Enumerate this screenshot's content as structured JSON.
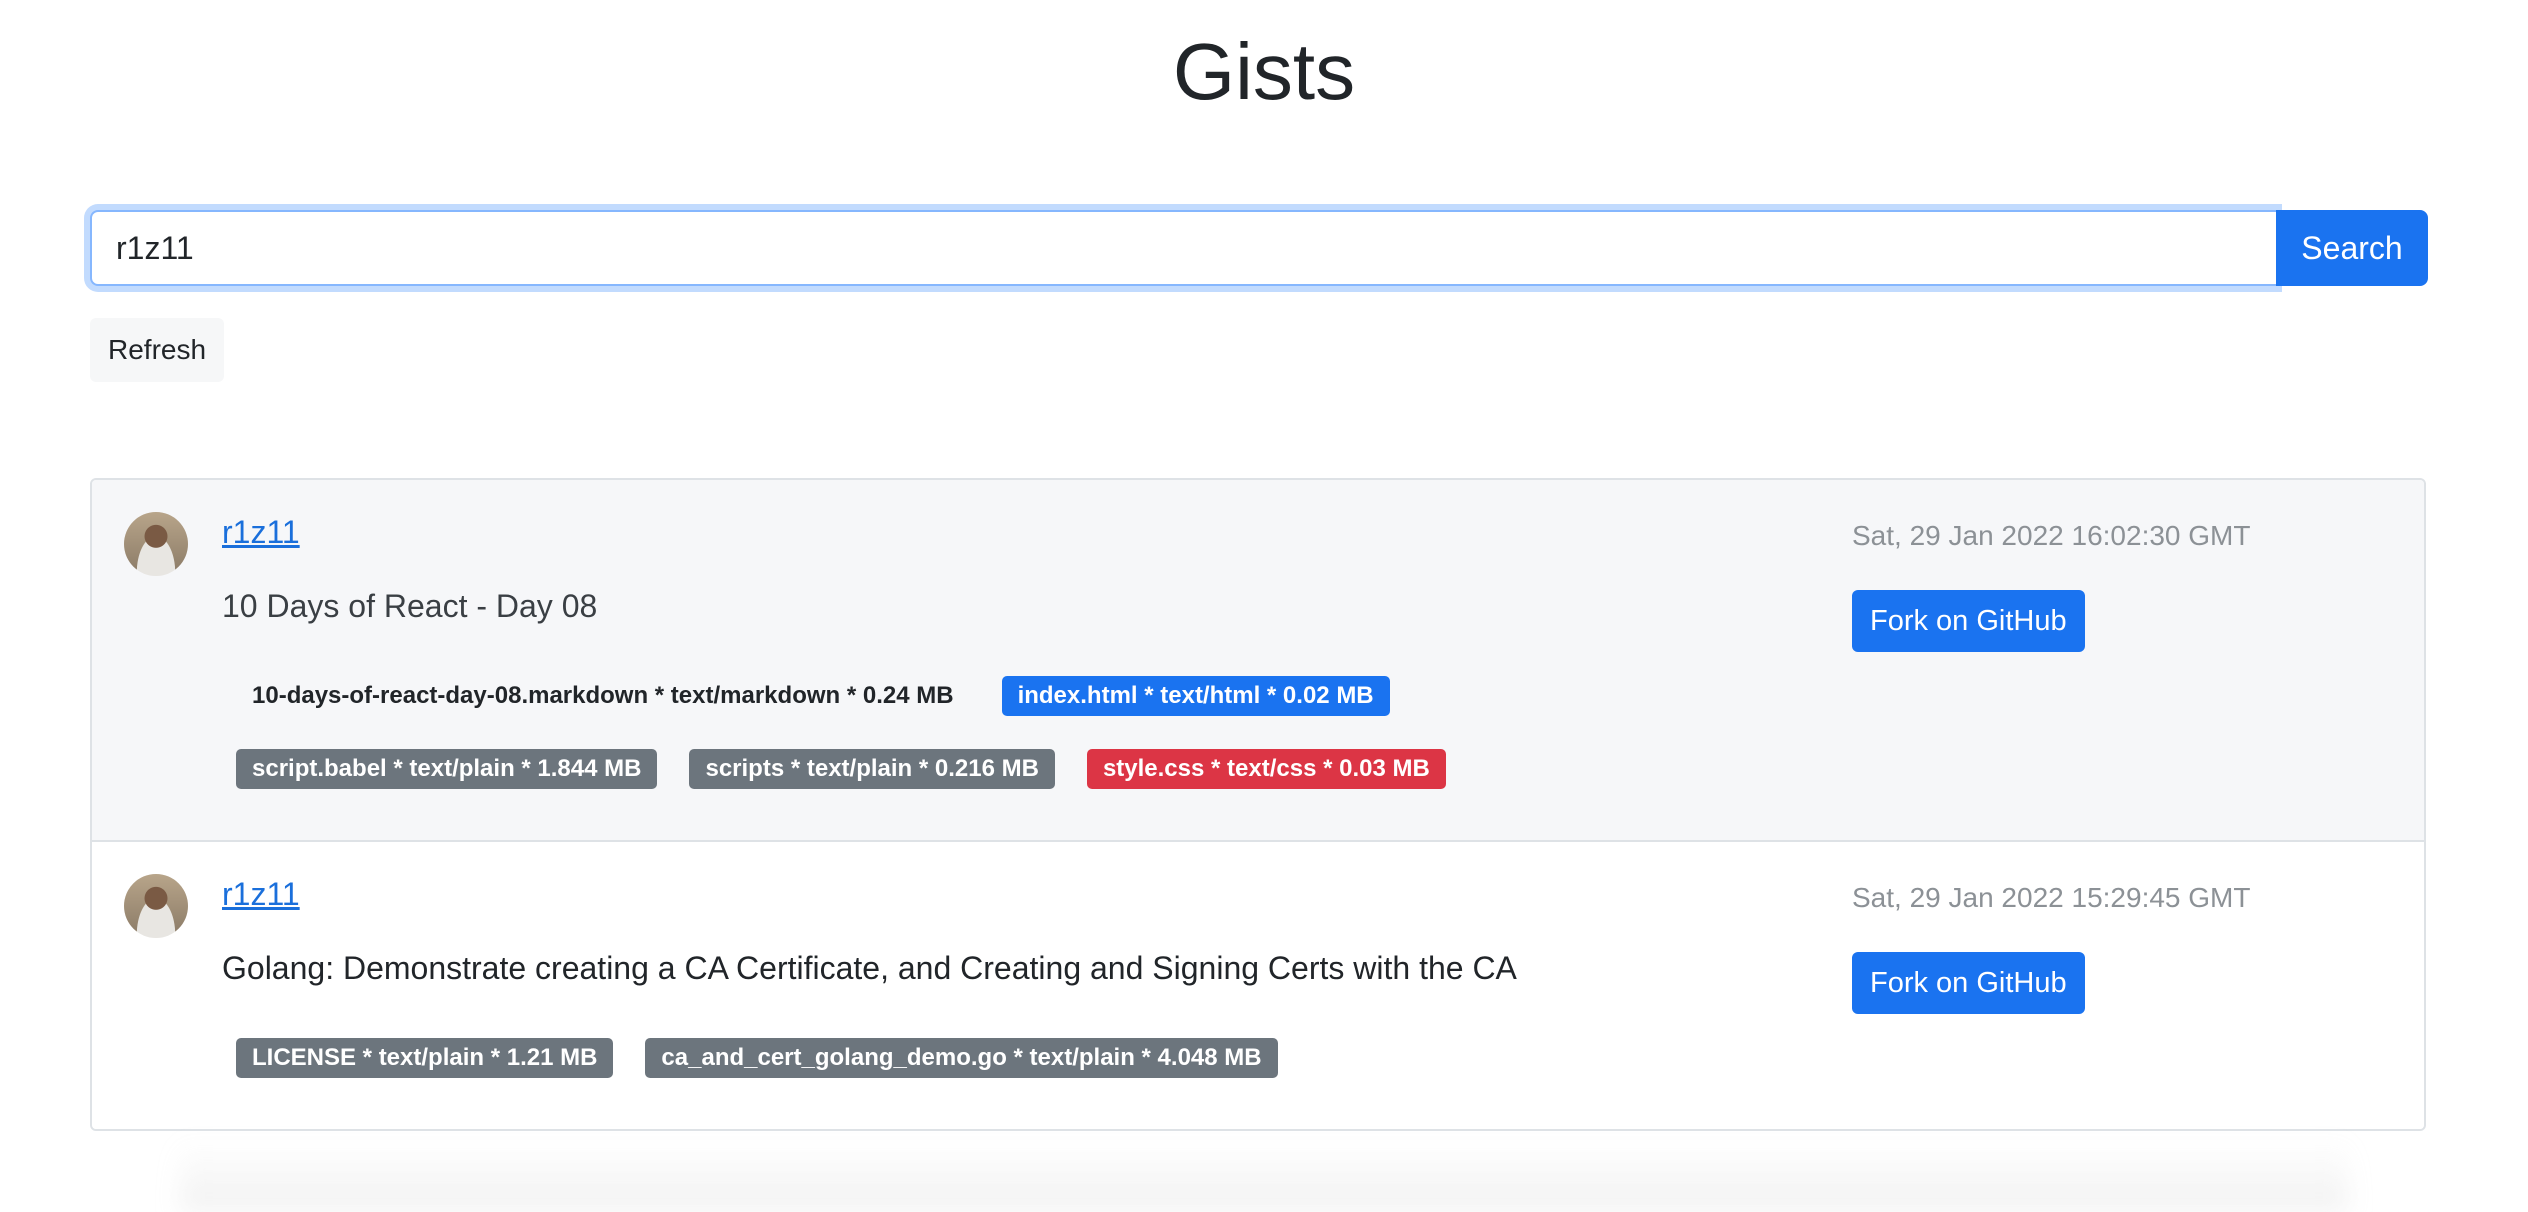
{
  "header": {
    "title": "Gists"
  },
  "search": {
    "value": "r1z11",
    "button_label": "Search"
  },
  "refresh_label": "Refresh",
  "gists": [
    {
      "user": "r1z11",
      "description": "10 Days of React - Day 08",
      "date": "Sat, 29 Jan 2022 16:02:30 GMT",
      "fork_label": "Fork on GitHub",
      "files_row1": [
        {
          "label": "10-days-of-react-day-08.markdown * text/markdown * 0.24 MB",
          "style": "light"
        },
        {
          "label": "index.html * text/html * 0.02 MB",
          "style": "primary"
        }
      ],
      "files_row2": [
        {
          "label": "script.babel * text/plain * 1.844 MB",
          "style": "secondary"
        },
        {
          "label": "scripts * text/plain * 0.216 MB",
          "style": "secondary"
        },
        {
          "label": "style.css * text/css * 0.03 MB",
          "style": "danger"
        }
      ]
    },
    {
      "user": "r1z11",
      "description": "Golang: Demonstrate creating a CA Certificate, and Creating and Signing Certs with the CA",
      "date": "Sat, 29 Jan 2022 15:29:45 GMT",
      "fork_label": "Fork on GitHub",
      "files_row1": [
        {
          "label": "LICENSE * text/plain * 1.21 MB",
          "style": "secondary"
        },
        {
          "label": "ca_and_cert_golang_demo.go * text/plain * 4.048 MB",
          "style": "secondary"
        }
      ]
    }
  ],
  "colors": {
    "primary": "#1a73f0",
    "secondary": "#6c757d",
    "danger": "#dc3545",
    "link": "#1a6fdb",
    "muted": "#8c9196"
  }
}
